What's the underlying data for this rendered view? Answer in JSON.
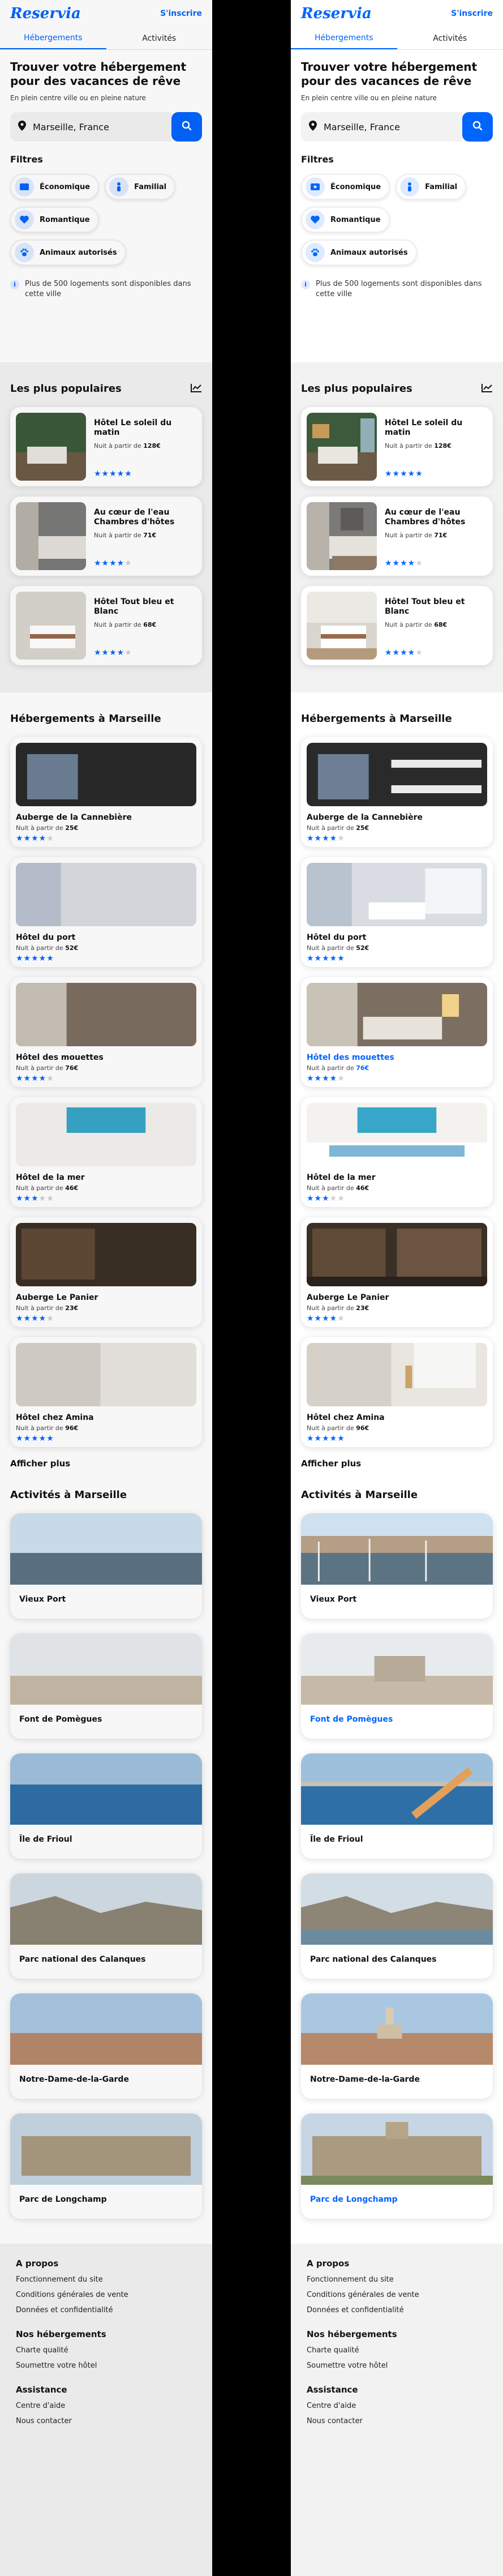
{
  "app": {
    "logo": "Reservia",
    "signup": "S'inscrire"
  },
  "tabs": [
    "Hébergements",
    "Activités"
  ],
  "hero": {
    "title": "Trouver votre hébergement pour des vacances de rêve",
    "subtitle": "En plein centre ville ou en pleine nature",
    "search_value": "Marseille, France"
  },
  "filters": {
    "title": "Filtres",
    "items": [
      {
        "label": "Économique",
        "icon": "money-icon"
      },
      {
        "label": "Familial",
        "icon": "family-icon"
      },
      {
        "label": "Romantique",
        "icon": "heart-icon"
      },
      {
        "label": "Animaux autorisés",
        "icon": "paw-icon"
      }
    ],
    "info": "Plus de 500 logements sont disponibles dans cette ville"
  },
  "popular": {
    "title": "Les plus populaires",
    "items": [
      {
        "name": "Hôtel Le soleil du matin",
        "price_prefix": "Nuit à partir de",
        "price": "128€",
        "rating": 5
      },
      {
        "name": "Au cœur de l'eau Chambres d'hôtes",
        "price_prefix": "Nuit à partir de",
        "price": "71€",
        "rating": 4
      },
      {
        "name": "Hôtel Tout bleu et Blanc",
        "price_prefix": "Nuit à partir de",
        "price": "68€",
        "rating": 4
      }
    ]
  },
  "lodgings": {
    "title": "Hébergements à Marseille",
    "more": "Afficher plus",
    "items": [
      {
        "name": "Auberge de la Cannebière",
        "price_prefix": "Nuit à partir de",
        "price": "25€",
        "rating": 4
      },
      {
        "name": "Hôtel du port",
        "price_prefix": "Nuit à partir de",
        "price": "52€",
        "rating": 5
      },
      {
        "name": "Hôtel des mouettes",
        "price_prefix": "Nuit à partir de",
        "price": "76€",
        "rating": 4
      },
      {
        "name": "Hôtel de la mer",
        "price_prefix": "Nuit à partir de",
        "price": "46€",
        "rating": 3
      },
      {
        "name": "Auberge Le Panier",
        "price_prefix": "Nuit à partir de",
        "price": "23€",
        "rating": 4
      },
      {
        "name": "Hôtel chez Amina",
        "price_prefix": "Nuit à partir de",
        "price": "96€",
        "rating": 5
      }
    ]
  },
  "activities": {
    "title": "Activités à Marseille",
    "items": [
      "Vieux Port",
      "Font de Pomègues",
      "Île de Frioul",
      "Parc national des Calanques",
      "Notre-Dame-de-la-Garde",
      "Parc de Longchamp"
    ]
  },
  "footer": {
    "sections": [
      {
        "title": "A propos",
        "links": [
          "Fonctionnement du site",
          "Conditions générales de vente",
          "Données et confidentialité"
        ]
      },
      {
        "title": "Nos hébergements",
        "links": [
          "Charte qualité",
          "Soumettre votre hôtel"
        ]
      },
      {
        "title": "Assistance",
        "links": [
          "Centre d'aide",
          "Nous contacter"
        ]
      }
    ]
  },
  "colors": {
    "accent": "#0065fc",
    "chip_bg": "#deebff",
    "background": "#f2f2f2"
  }
}
